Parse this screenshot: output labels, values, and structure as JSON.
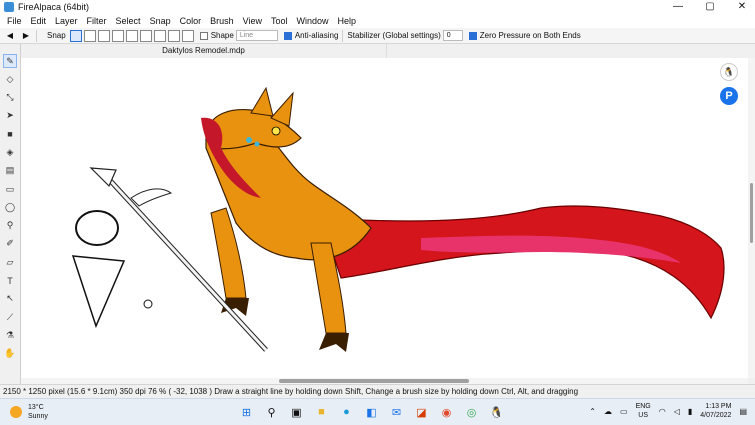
{
  "window": {
    "title": "FireAlpaca (64bit)",
    "controls": [
      "—",
      "▢",
      "✕"
    ]
  },
  "menu": [
    "File",
    "Edit",
    "Layer",
    "Filter",
    "Select",
    "Snap",
    "Color",
    "Brush",
    "View",
    "Tool",
    "Window",
    "Help"
  ],
  "toolbar": {
    "snap_label": "Snap",
    "shape_label": "Shape",
    "shape_value": "Line",
    "antialias_label": "Anti-aliasing",
    "stabilizer_label": "Stabilizer (Global settings)",
    "stabilizer_value": "0",
    "zero_pressure_label": "Zero Pressure on Both Ends"
  },
  "document": {
    "tab_title": "Daktylos Remodel.mdp"
  },
  "status": {
    "text": "2150 * 1250 pixel   (15.6 * 9.1cm)   350 dpi   76 %   ( -32, 1038 )   Draw a straight line by holding down Shift, Change a brush size by holding down Ctrl, Alt, and dragging"
  },
  "taskbar": {
    "temperature": "13°C",
    "condition": "Sunny",
    "language": "ENG",
    "region": "US",
    "time": "1:13 PM",
    "date": "4/07/2022"
  },
  "colors": {
    "accent": "#2a6fd6",
    "creature_orange": "#e8920f",
    "tail_red": "#d4151b",
    "tail_pink": "#e8326a"
  }
}
